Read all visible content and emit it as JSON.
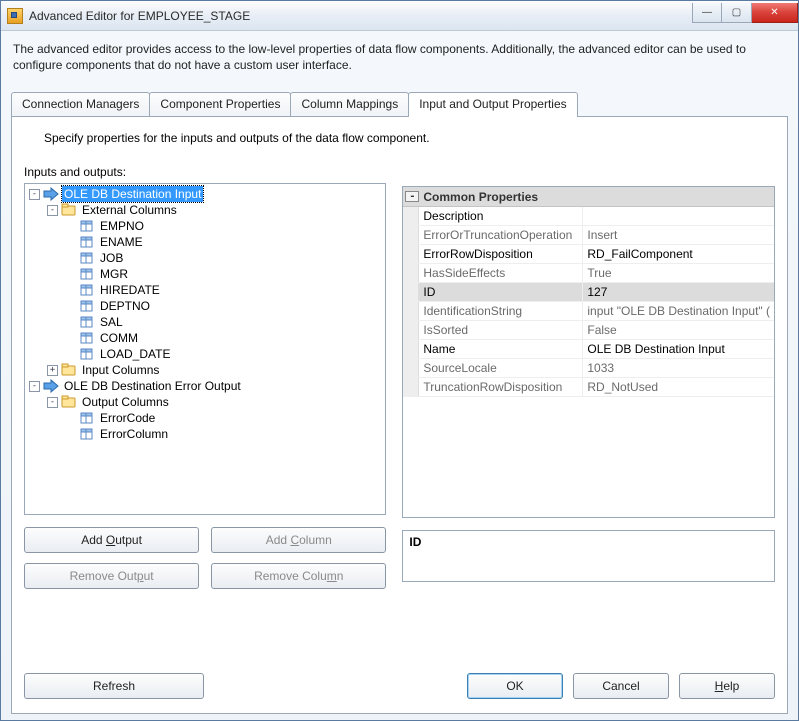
{
  "window": {
    "title": "Advanced Editor for EMPLOYEE_STAGE"
  },
  "description": "The advanced editor provides access to the low-level properties of data flow components. Additionally, the advanced editor can be used to configure components that do not have a custom user interface.",
  "tabs": [
    {
      "label": "Connection Managers"
    },
    {
      "label": "Component Properties"
    },
    {
      "label": "Column Mappings"
    },
    {
      "label": "Input and Output Properties"
    }
  ],
  "instruction": "Specify properties for the inputs and outputs of the data flow component.",
  "treeLabel": "Inputs and outputs:",
  "tree": {
    "root": "OLE DB Destination Input",
    "extCols": "External Columns",
    "cols": [
      "EMPNO",
      "ENAME",
      "JOB",
      "MGR",
      "HIREDATE",
      "DEPTNO",
      "SAL",
      "COMM",
      "LOAD_DATE"
    ],
    "inputCols": "Input Columns",
    "errOut": "OLE DB Destination Error Output",
    "outCols": "Output Columns",
    "errCols": [
      "ErrorCode",
      "ErrorColumn"
    ]
  },
  "buttons": {
    "addOutput": "Add Output",
    "addColumn": "Add Column",
    "removeOutput": "Remove Output",
    "removeColumn": "Remove Column",
    "refresh": "Refresh",
    "ok": "OK",
    "cancel": "Cancel",
    "help": "Help"
  },
  "propCategory": "Common Properties",
  "props": [
    {
      "k": "Description",
      "v": "",
      "active": true
    },
    {
      "k": "ErrorOrTruncationOperation",
      "v": "Insert"
    },
    {
      "k": "ErrorRowDisposition",
      "v": "RD_FailComponent",
      "active": true
    },
    {
      "k": "HasSideEffects",
      "v": "True"
    },
    {
      "k": "ID",
      "v": "127",
      "highlight": true
    },
    {
      "k": "IdentificationString",
      "v": "input \"OLE DB Destination Input\" ("
    },
    {
      "k": "IsSorted",
      "v": "False"
    },
    {
      "k": "Name",
      "v": "OLE DB Destination Input",
      "active": true
    },
    {
      "k": "SourceLocale",
      "v": "1033"
    },
    {
      "k": "TruncationRowDisposition",
      "v": "RD_NotUsed"
    }
  ],
  "helpPane": {
    "title": "ID",
    "body": ""
  }
}
